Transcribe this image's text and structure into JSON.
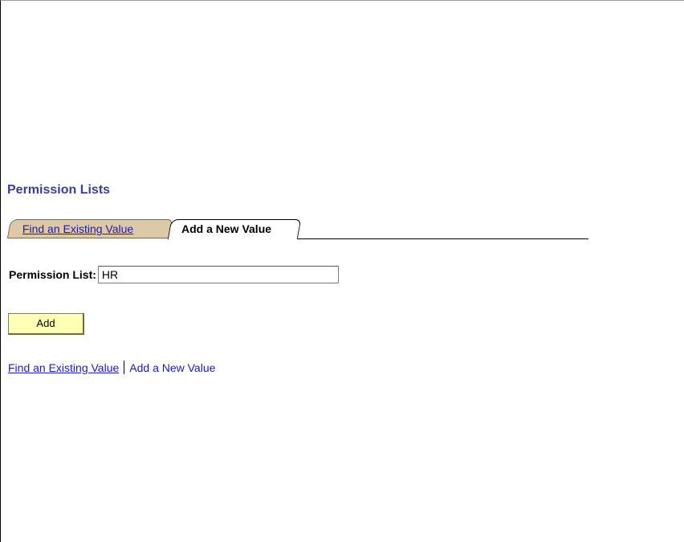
{
  "page": {
    "title": "Permission Lists"
  },
  "tabs": [
    {
      "label": "Find an Existing Value",
      "active": false
    },
    {
      "label": "Add a New Value",
      "active": true
    }
  ],
  "form": {
    "field_label": "Permission List:",
    "field_value": "HR",
    "add_button_label": "Add"
  },
  "links": {
    "find_label": "Find an Existing Value",
    "add_label": "Add a New Value"
  },
  "colors": {
    "title": "#3c3c9a",
    "link": "#1a1ab8",
    "inactive_tab": "#ddc9a7",
    "button": "#ffffb3"
  }
}
